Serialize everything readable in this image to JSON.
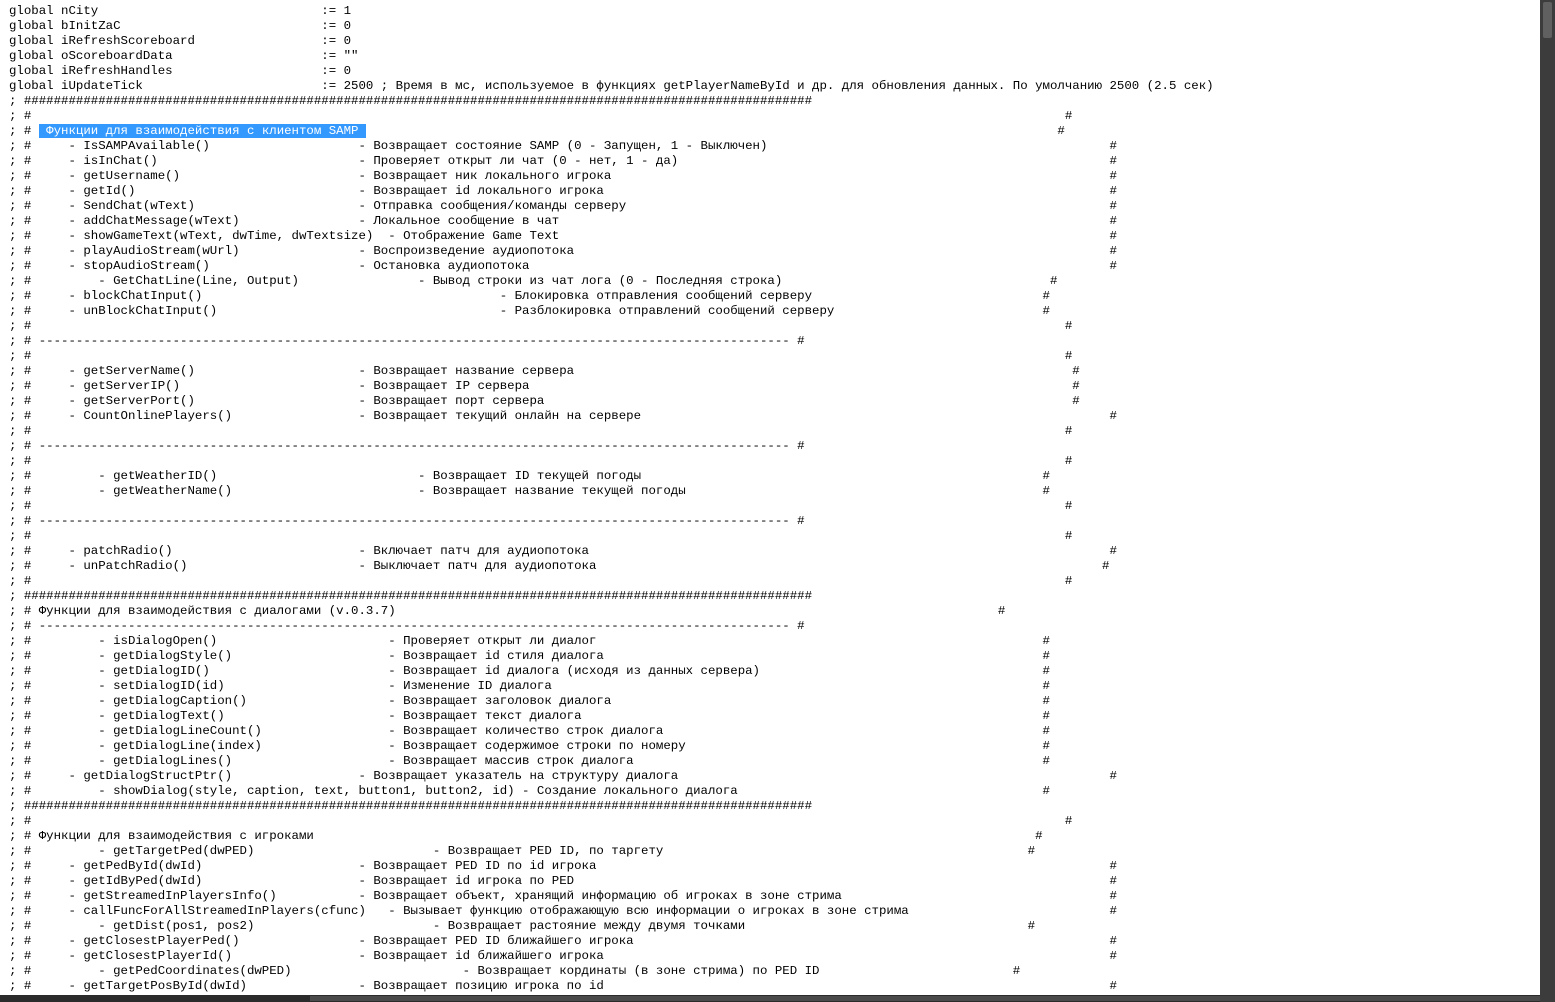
{
  "selected_text": " Функции для взаимодействия с клиентом SAMP ",
  "lines": [
    "global nCity                              := 1",
    "global bInitZaC                           := 0",
    "global iRefreshScoreboard                 := 0",
    "global oScoreboardData                    := \"\"",
    "global iRefreshHandles                    := 0",
    "global iUpdateTick                        := 2500 ; Время в мс, используемое в функциях getPlayerNameById и др. для обновления данных. По умолчанию 2500 (2.5 сек)",
    "; ##########################################################################################################",
    "; #                                                                                                                                           #",
    "; # @@SEL@@                                                                                             #",
    "; #     - IsSAMPAvailable()                    - Возвращает состояние SAMP (0 - Запущен, 1 - Выключен)                                              #",
    "; #     - isInChat()                           - Проверяет открыт ли чат (0 - нет, 1 - да)                                                          #",
    "; #     - getUsername()                        - Возвращает ник локального игрока                                                                   #",
    "; #     - getId()                              - Возвращает id локального игрока                                                                    #",
    "; #     - SendChat(wText)                      - Отправка сообщения/команды серверу                                                                 #",
    "; #     - addChatMessage(wText)                - Локальное сообщение в чат                                                                          #",
    "; #     - showGameText(wText, dwTime, dwTextsize)  - Отображение Game Text                                                                          #",
    "; #     - playAudioStream(wUrl)                - Воспроизведение аудиопотока                                                                        #",
    "; #     - stopAudioStream()                    - Остановка аудиопотока                                                                              #",
    "; #         - GetChatLine(Line, Output)                - Вывод строки из чат лога (0 - Последняя строка)                                    #",
    "; #     - blockChatInput()                                        - Блокировка отправления сообщений серверу                               #",
    "; #     - unBlockChatInput()                                      - Разблокировка отправлений сообщений серверу                            #",
    "; #                                                                                                                                           #",
    "; # ----------------------------------------------------------------------------------------------------- #",
    "; #                                                                                                                                           #",
    "; #     - getServerName()                      - Возвращает название сервера                                                                   #",
    "; #     - getServerIP()                        - Возвращает IP сервера                                                                         #",
    "; #     - getServerPort()                      - Возвращает порт сервера                                                                       #",
    "; #     - CountOnlinePlayers()                 - Возвращает текущий онлайн на сервере                                                               #",
    "; #                                                                                                                                           #",
    "; # ----------------------------------------------------------------------------------------------------- #",
    "; #                                                                                                                                           #",
    "; #         - getWeatherID()                           - Возвращает ID текущей погоды                                                      #",
    "; #         - getWeatherName()                         - Возвращает название текущей погоды                                                #",
    "; #                                                                                                                                           #",
    "; # ----------------------------------------------------------------------------------------------------- #",
    "; #                                                                                                                                           #",
    "; #     - patchRadio()                         - Включает патч для аудиопотока                                                                      #",
    "; #     - unPatchRadio()                       - Выключает патч для аудиопотока                                                                    #",
    "; #                                                                                                                                           #",
    "; ##########################################################################################################",
    "; # Функции для взаимодействия с диалогами (v.0.3.7)                                                                                 #",
    "; # ----------------------------------------------------------------------------------------------------- #",
    "; #         - isDialogOpen()                       - Проверяет открыт ли диалог                                                            #",
    "; #         - getDialogStyle()                     - Возвращает id стиля диалога                                                           #",
    "; #         - getDialogID()                        - Возвращает id диалога (исходя из данных сервера)                                      #",
    "; #         - setDialogID(id)                      - Изменение ID диалога                                                                  #",
    "; #         - getDialogCaption()                   - Возвращает заголовок диалога                                                          #",
    "; #         - getDialogText()                      - Возвращает текст диалога                                                              #",
    "; #         - getDialogLineCount()                 - Возвращает количество строк диалога                                                   #",
    "; #         - getDialogLine(index)                 - Возвращает содержимое строки по номеру                                                #",
    "; #         - getDialogLines()                     - Возвращает массив строк диалога                                                       #",
    "; #     - getDialogStructPtr()                 - Возвращает указатель на структуру диалога                                                          #",
    "; #         - showDialog(style, caption, text, button1, button2, id) - Создание локального диалога                                         #",
    "; ##########################################################################################################",
    "; #                                                                                                                                           #",
    "; # Функции для взаимодействия с игроками                                                                                                 #",
    "; #         - getTargetPed(dwPED)                        - Возвращает PED ID, по таргету                                                 #",
    "; #     - getPedById(dwId)                     - Возвращает PED ID по id игрока                                                                     #",
    "; #     - getIdByPed(dwId)                     - Возвращает id игрока по PED                                                                        #",
    "; #     - getStreamedInPlayersInfo()           - Возвращает объект, хранящий информацию об игроках в зоне стрима                                    #",
    "; #     - callFuncForAllStreamedInPlayers(cfunc)   - Вызывает функцию отображающую всю информации о игроках в зоне стрима                           #",
    "; #         - getDist(pos1, pos2)                        - Возвращает растояние между двумя точками                                      #",
    "; #     - getClosestPlayerPed()                - Возвращает PED ID ближайшего игрока                                                                #",
    "; #     - getClosestPlayerId()                 - Возвращает id ближайшего игрока                                                                    #",
    "; #         - getPedCoordinates(dwPED)                       - Возвращает кординаты (в зоне стрима) по PED ID                          #",
    "; #     - getTargetPosById(dwId)               - Возвращает позицию игрока по id                                                                    #"
  ]
}
